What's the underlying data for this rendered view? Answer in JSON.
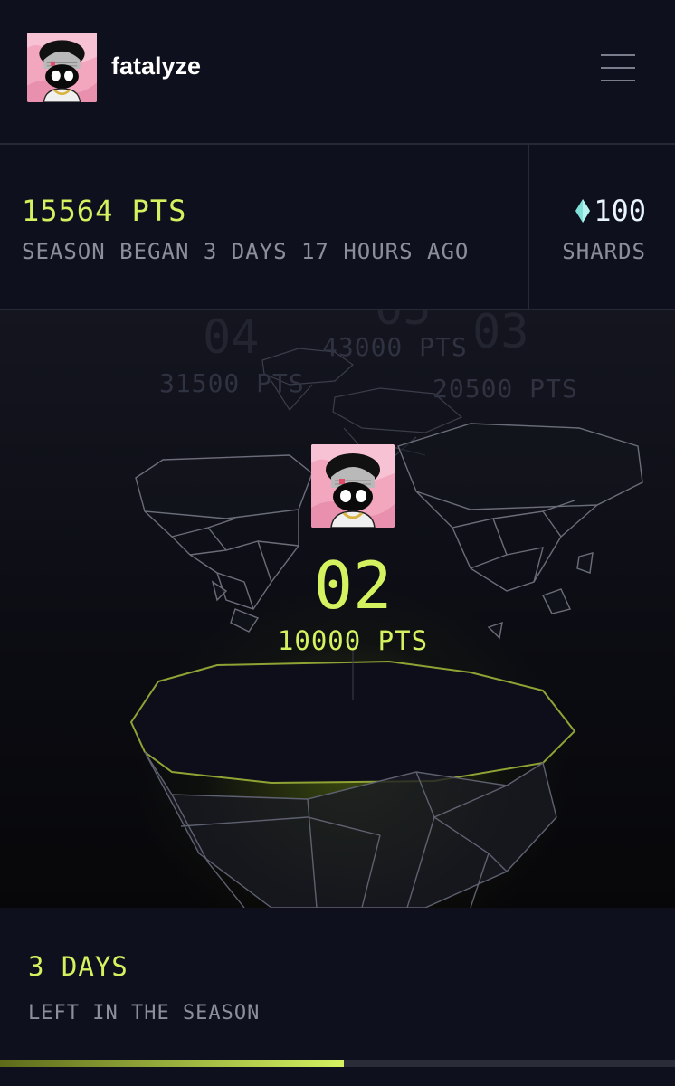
{
  "user": {
    "name": "fatalyze",
    "avatar": "avatar-portrait"
  },
  "stats": {
    "points": "15564 PTS",
    "season_info": "SEASON BEGAN 3 DAYS 17 HOURS AGO",
    "shards_icon": "diamond-icon",
    "shards_value": "100",
    "shards_label": "SHARDS"
  },
  "leaderboard": {
    "ranks": [
      {
        "rank": "04",
        "points": "31500 PTS"
      },
      {
        "rank": "05",
        "points": "43000 PTS"
      },
      {
        "rank": "03",
        "points": "20500 PTS"
      }
    ],
    "current": {
      "rank": "02",
      "points": "10000 PTS"
    }
  },
  "season": {
    "days_left": "3 DAYS",
    "days_left_label": "LEFT IN THE SEASON",
    "progress": 0.51
  },
  "colors": {
    "accent": "#d4f260",
    "background": "#0e0f1a",
    "muted": "#8b8f9c"
  }
}
